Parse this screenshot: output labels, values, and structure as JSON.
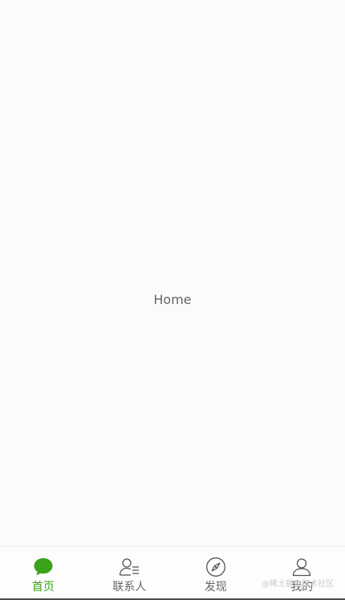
{
  "main": {
    "text": "Home"
  },
  "tabbar": {
    "active_color": "#3aa318",
    "inactive_color": "#666666",
    "tabs": [
      {
        "label": "首页",
        "icon": "chat-bubble-icon",
        "active": true
      },
      {
        "label": "联系人",
        "icon": "contacts-icon",
        "active": false
      },
      {
        "label": "发现",
        "icon": "compass-icon",
        "active": false
      },
      {
        "label": "我的",
        "icon": "user-icon",
        "active": false
      }
    ]
  },
  "watermark": "@稀土掘金技术社区"
}
